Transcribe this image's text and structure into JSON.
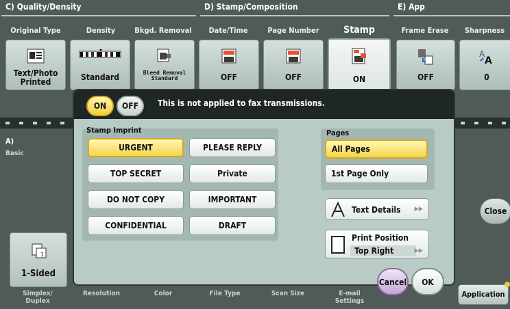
{
  "categories": [
    {
      "id": "c",
      "label": "C)  Quality/Density"
    },
    {
      "id": "d",
      "label": "D)  Stamp/Composition"
    },
    {
      "id": "e",
      "label": "E)  App"
    }
  ],
  "tabs": [
    {
      "label": "Original Type",
      "value": "Text/Photo Printed",
      "icon": "document-photo-icon"
    },
    {
      "label": "Density",
      "value": "Standard",
      "icon": "density-scale-icon"
    },
    {
      "label": "Bkgd. Removal",
      "value": "Bleed Removal Standard",
      "icon": "background-removal-icon"
    },
    {
      "label": "Date/Time",
      "value": "OFF",
      "icon": "date-time-stamp-icon"
    },
    {
      "label": "Page Number",
      "value": "OFF",
      "icon": "page-number-icon"
    },
    {
      "label": "Stamp",
      "value": "ON",
      "icon": "stamp-icon"
    },
    {
      "label": "Frame Erase",
      "value": "OFF",
      "icon": "frame-erase-icon"
    },
    {
      "label": "Sharpness",
      "value": "0",
      "icon": "sharpness-icon"
    }
  ],
  "side": {
    "letter": "A)",
    "label": "Basic"
  },
  "one_sided": {
    "value": "1-Sided",
    "icon": "simplex-icon"
  },
  "bottom_labels": [
    "Simplex/\nDuplex",
    "Resolution",
    "Color",
    "File Type",
    "Scan Size",
    "E-mail\nSettings"
  ],
  "application_label": "Application",
  "close_label": "Close",
  "dialog": {
    "on_label": "ON",
    "off_label": "OFF",
    "note": "This is not applied to fax transmissions.",
    "stamp_imprint_title": "Stamp Imprint",
    "stamps": [
      "URGENT",
      "PLEASE REPLY",
      "TOP SECRET",
      "Private",
      "DO NOT COPY",
      "IMPORTANT",
      "CONFIDENTIAL",
      "DRAFT"
    ],
    "selected_stamp": "URGENT",
    "pages_title": "Pages",
    "pages": [
      "All Pages",
      "1st Page Only"
    ],
    "selected_page": "All Pages",
    "text_details_label": "Text Details",
    "print_position_label": "Print Position",
    "print_position_value": "Top Right",
    "cancel_label": "Cancel",
    "ok_label": "OK"
  },
  "colors": {
    "panel_bg": "#4f5a59",
    "dialog_bg": "#b9cbc7",
    "selected_yellow": "#f5d54a",
    "cancel_purple": "#c6a6d6"
  }
}
